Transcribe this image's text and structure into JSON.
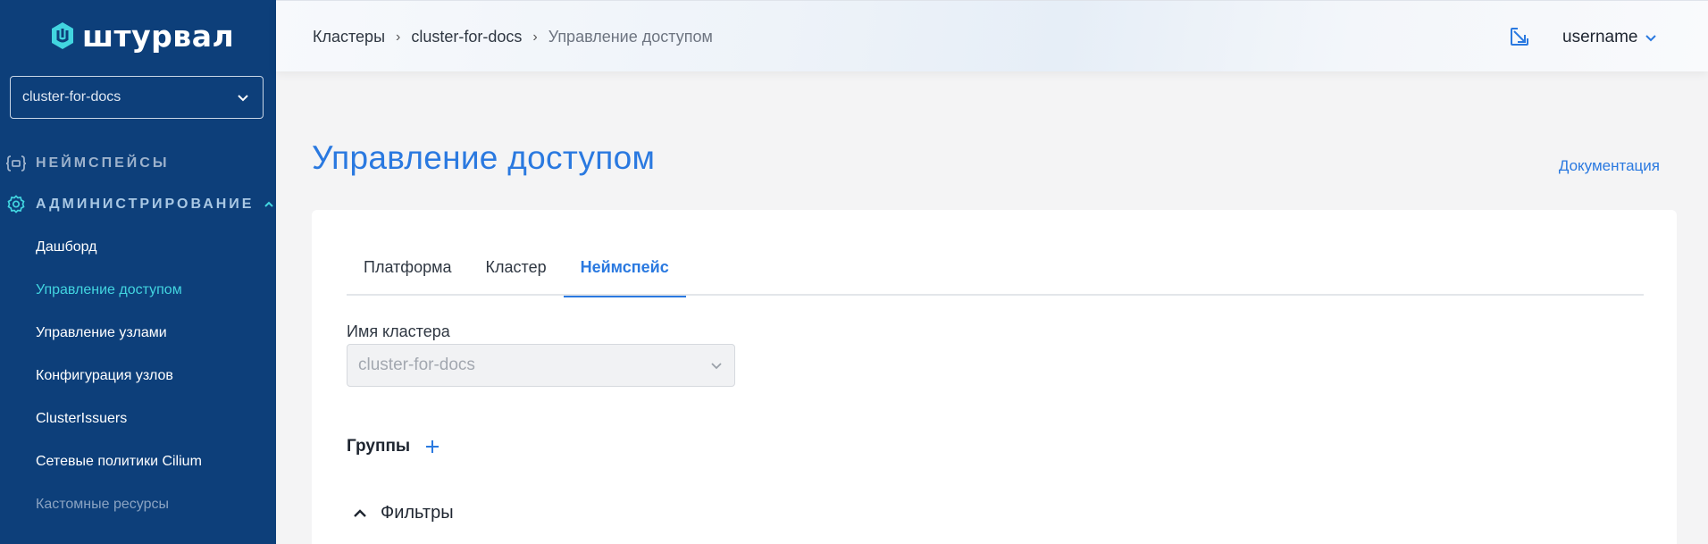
{
  "brand": {
    "name": "штурвал",
    "color": "#42d5e0"
  },
  "sidebar": {
    "cluster_select": {
      "value": "cluster-for-docs"
    },
    "sections": [
      {
        "label": "НЕЙМСПЕЙСЫ",
        "icon": "braces-icon"
      },
      {
        "label": "АДМИНИСТРИРОВАНИЕ",
        "icon": "gear-icon",
        "expanded": true
      }
    ],
    "items": [
      {
        "label": "Дашборд"
      },
      {
        "label": "Управление доступом",
        "active": true
      },
      {
        "label": "Управление узлами"
      },
      {
        "label": "Конфигурация узлов"
      },
      {
        "label": "ClusterIssuers"
      },
      {
        "label": "Сетевые политики Cilium"
      },
      {
        "label": "Кастомные ресурсы"
      }
    ]
  },
  "header": {
    "breadcrumb": [
      "Кластеры",
      "cluster-for-docs",
      "Управление доступом"
    ],
    "user": "username",
    "icons": [
      "open-external-icon",
      "chevron-down-icon"
    ]
  },
  "main": {
    "title": "Управление доступом",
    "doc_link": "Документация",
    "tabs": [
      {
        "label": "Платформа"
      },
      {
        "label": "Кластер"
      },
      {
        "label": "Неймспейс",
        "active": true
      }
    ],
    "cluster_field": {
      "label": "Имя кластера",
      "value": "cluster-for-docs"
    },
    "groups_title": "Группы",
    "filters_label": "Фильтры"
  },
  "colors": {
    "sidebar_bg": "#0d3f7a",
    "accent": "#2a79e0",
    "active_nav": "#42d5e0"
  }
}
